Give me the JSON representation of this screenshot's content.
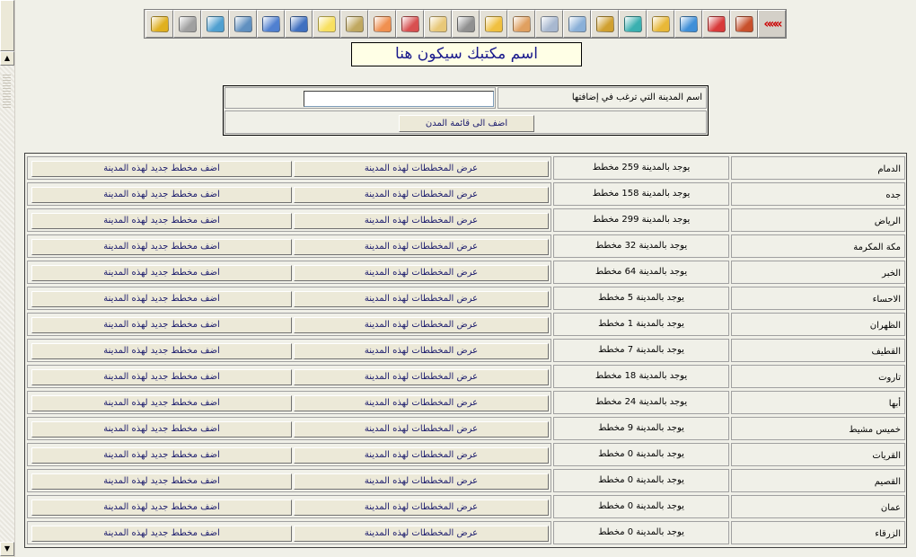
{
  "toolbar": {
    "buttons": [
      {
        "name": "back-icon",
        "glyph": "«««",
        "color": "#cc0000"
      },
      {
        "name": "home-icon",
        "color": "#c8502c"
      },
      {
        "name": "red-folder-icon",
        "color": "#d83a3a"
      },
      {
        "name": "blue-folder-icon",
        "color": "#3f8fd8"
      },
      {
        "name": "yellow-folder-icon",
        "color": "#e8b838"
      },
      {
        "name": "teal-folder-icon",
        "color": "#3ab0b0"
      },
      {
        "name": "cubes-icon",
        "color": "#d0a030"
      },
      {
        "name": "drive-arrow-icon",
        "color": "#8ab0d8"
      },
      {
        "name": "drive-icon",
        "color": "#a8b8d0"
      },
      {
        "name": "house-plan-icon",
        "color": "#e0a060"
      },
      {
        "name": "weather-icon",
        "color": "#f0c040"
      },
      {
        "name": "tools-icon",
        "color": "#909090"
      },
      {
        "name": "clipboard-icon",
        "color": "#e8c878"
      },
      {
        "name": "edit-form-icon",
        "color": "#d85050"
      },
      {
        "name": "users-icon",
        "color": "#f09050"
      },
      {
        "name": "import-icon",
        "color": "#c0a860"
      },
      {
        "name": "note-icon",
        "color": "#f8e060"
      },
      {
        "name": "save-as-icon",
        "color": "#4070c0"
      },
      {
        "name": "save-icon",
        "color": "#5080d0"
      },
      {
        "name": "network-icon",
        "color": "#6090c0"
      },
      {
        "name": "export-icon",
        "color": "#50a0d0"
      },
      {
        "name": "printer-icon",
        "color": "#a0a0a0"
      },
      {
        "name": "lock-icon",
        "color": "#e0b020"
      }
    ]
  },
  "title": "اسم مكتبك سيكون هنا",
  "add_city": {
    "label": "اسم المدينة التي ترغب في إضافتها",
    "input_value": "",
    "button_label": "اضف الى قائمة المدن"
  },
  "cities": [
    {
      "name": "الدمام",
      "count": "يوجد بالمدينة 259 مخطط"
    },
    {
      "name": "جده",
      "count": "يوجد بالمدينة 158 مخطط"
    },
    {
      "name": "الرياض",
      "count": "يوجد بالمدينة 299 مخطط"
    },
    {
      "name": "مكة المكرمة",
      "count": "يوجد بالمدينة 32 مخطط"
    },
    {
      "name": "الخبر",
      "count": "يوجد بالمدينة 64 مخطط"
    },
    {
      "name": "الاحساء",
      "count": "يوجد بالمدينة 5 مخطط"
    },
    {
      "name": "الظهران",
      "count": "يوجد بالمدينة 1 مخطط"
    },
    {
      "name": "القطيف",
      "count": "يوجد بالمدينة 7 مخطط"
    },
    {
      "name": "تاروت",
      "count": "يوجد بالمدينة 18 مخطط"
    },
    {
      "name": "أبها",
      "count": "يوجد بالمدينة 24 مخطط"
    },
    {
      "name": "خميس مشيط",
      "count": "يوجد بالمدينة 9 مخطط"
    },
    {
      "name": "القريات",
      "count": "يوجد بالمدينة 0 مخطط"
    },
    {
      "name": "القصيم",
      "count": "يوجد بالمدينة 0 مخطط"
    },
    {
      "name": "عمان",
      "count": "يوجد بالمدينة 0 مخطط"
    },
    {
      "name": "الزرقاء",
      "count": "يوجد بالمدينة 0 مخطط"
    }
  ],
  "row_buttons": {
    "show_label": "عرض المخططات لهذه المدينة",
    "add_label": "اضف مخطط جديد لهذه المدينة"
  }
}
